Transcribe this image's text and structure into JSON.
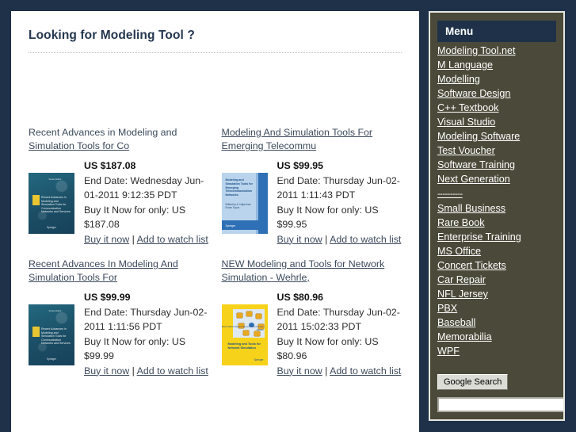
{
  "theme": {
    "page_background": "#1e3148",
    "content_background": "#ffffff",
    "sidebar_background": "#4b4a3a",
    "menu_header_background": "#1e3148",
    "heading_color": "#24364e",
    "link_color": "#3d4a5c"
  },
  "main": {
    "title": "Looking for Modeling Tool ?",
    "listings": [
      {
        "title_line1": "Recent Advances in Modeling and",
        "title_line2": "Simulation Tools for Co",
        "price": "US $187.08",
        "end_date": "End Date: Wednesday Jun-01-2011 9:12:35 PDT",
        "buy_it_now": "Buy It Now for only: US $187.08",
        "buy_link": "Buy it now",
        "separator": "|",
        "watch_link": "Add to watch list",
        "cover": "recent-advances-modeling-simulation-tools-teal"
      },
      {
        "title_line1": "Modeling And Simulation Tools For",
        "title_line2": "Emerging Telecommu",
        "price": "US $99.95",
        "end_date": "End Date: Thursday Jun-02-2011 1:11:43 PDT",
        "buy_it_now": "Buy It Now for only: US $99.95",
        "buy_link": "Buy it now",
        "separator": "|",
        "watch_link": "Add to watch list",
        "cover": "modeling-simulation-tools-emerging-telecom-blue"
      },
      {
        "title_line1": "Recent Advances In Modeling And",
        "title_line2": "Simulation Tools For",
        "price": "US $99.99",
        "end_date": "End Date: Thursday Jun-02-2011 1:11:56 PDT",
        "buy_it_now": "Buy It Now for only: US $99.99",
        "buy_link": "Buy it now",
        "separator": "|",
        "watch_link": "Add to watch list",
        "cover": "recent-advances-modeling-simulation-tools-teal"
      },
      {
        "title_line1": "NEW Modeling and Tools for Network",
        "title_line2": "Simulation - Wehrle,",
        "price": "US $80.96",
        "end_date": "End Date: Thursday Jun-02-2011 15:02:33 PDT",
        "buy_it_now": "Buy It Now for only: US $80.96",
        "buy_link": "Buy it now",
        "separator": "|",
        "watch_link": "Add to watch list",
        "cover": "modeling-tools-network-simulation-yellow"
      }
    ]
  },
  "covers": {
    "teal": {
      "header": "Series Editor",
      "title": "Recent Advances in Modeling and Simulation Tools for Communication Networks and Services",
      "brand": "Springer"
    },
    "blue": {
      "title": "Modeling and Simulation Tools for Emerging Telecommunication Networks",
      "authors": "Edited by A. Nejat Ince Ercan Topuz",
      "brand": "Springer"
    },
    "yellow": {
      "title": "Modeling and Tools for Network Simulation",
      "authors": "Klaus Wehrle Mesut Guenes James Gross Editors",
      "brand": "Springer"
    }
  },
  "sidebar": {
    "menu_header": "Menu",
    "items": [
      {
        "label": "Modeling Tool.net"
      },
      {
        "label": "M Language"
      },
      {
        "label": "Modelling"
      },
      {
        "label": "Software Design"
      },
      {
        "label": "C++ Textbook"
      },
      {
        "label": "Visual Studio"
      },
      {
        "label": "Modeling Software"
      },
      {
        "label": "Test Voucher"
      },
      {
        "label": "Software Training"
      },
      {
        "label": "Next Generation"
      },
      {
        "label": "----------",
        "separator": true
      },
      {
        "label": "Small Business"
      },
      {
        "label": "Rare Book"
      },
      {
        "label": "Enterprise Training"
      },
      {
        "label": "MS Office"
      },
      {
        "label": "Concert Tickets"
      },
      {
        "label": "Car Repair"
      },
      {
        "label": "NFL Jersey"
      },
      {
        "label": "PBX"
      },
      {
        "label": "Baseball"
      },
      {
        "label": "Memorabilia"
      },
      {
        "label": "WPF"
      }
    ],
    "search": {
      "button_label": "Google Search",
      "input_value": "",
      "input_placeholder": ""
    }
  }
}
